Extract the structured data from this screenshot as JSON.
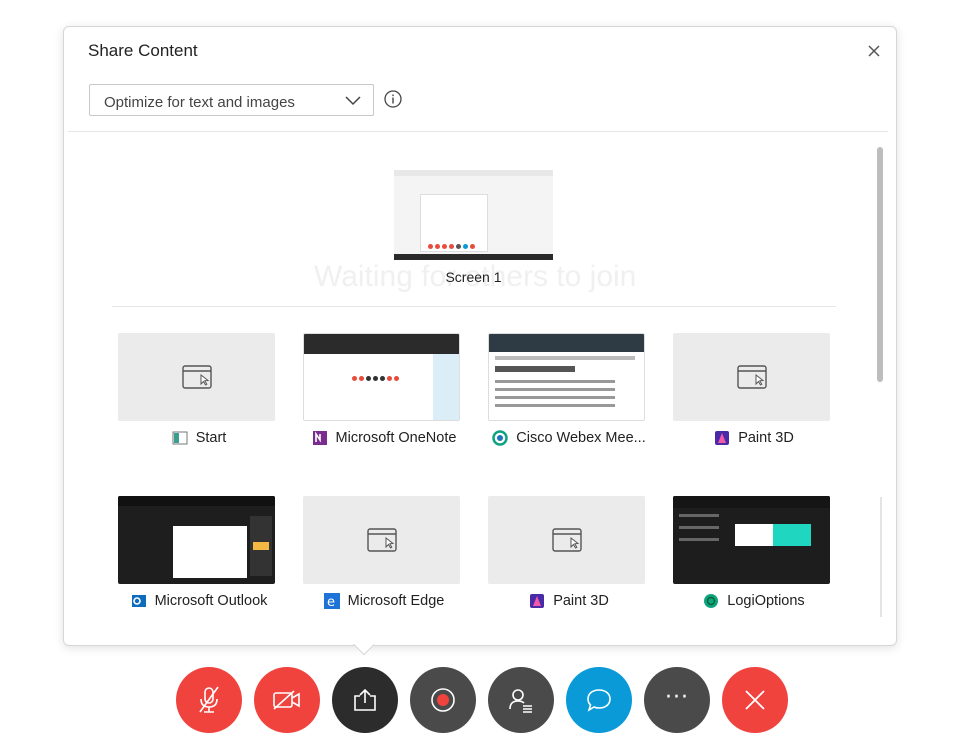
{
  "dialog": {
    "title": "Share Content",
    "optimize_selected": "Optimize for text and images",
    "screen_label": "Screen 1",
    "background_text": "Waiting for others to join"
  },
  "apps": [
    {
      "label": "Start",
      "icon": "start-app-icon",
      "preview": "blank"
    },
    {
      "label": "Microsoft OneNote",
      "icon": "onenote-icon",
      "preview": "onenote"
    },
    {
      "label": "Cisco Webex Mee...",
      "icon": "webex-icon",
      "preview": "webex"
    },
    {
      "label": "Paint 3D",
      "icon": "paint3d-icon",
      "preview": "blank"
    },
    {
      "label": "Microsoft Outlook",
      "icon": "outlook-icon",
      "preview": "outlook"
    },
    {
      "label": "Microsoft Edge",
      "icon": "edge-icon",
      "preview": "blank"
    },
    {
      "label": "Paint 3D",
      "icon": "paint3d-icon",
      "preview": "blank"
    },
    {
      "label": "LogiOptions",
      "icon": "logioptions-icon",
      "preview": "logi"
    }
  ],
  "toolbar": {
    "buttons": [
      "mute",
      "stop-video",
      "share",
      "record",
      "participants",
      "chat",
      "more",
      "end-meeting"
    ],
    "more_glyph": "···"
  },
  "colors": {
    "red": "#f0433e",
    "dark": "#2c2c2c",
    "gray": "#4a4a4a",
    "blue": "#0a9ad8"
  }
}
